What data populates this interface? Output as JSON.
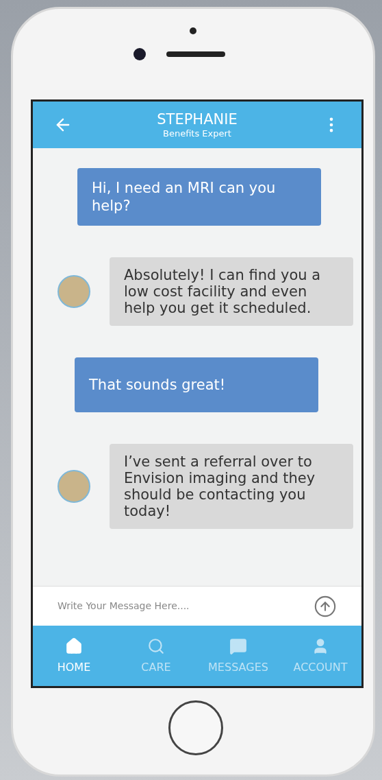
{
  "header": {
    "title": "STEPHANIE",
    "subtitle": "Benefits Expert"
  },
  "messages": [
    {
      "kind": "outgoing",
      "text": "Hi, I need an MRI can you help?"
    },
    {
      "kind": "incoming",
      "text": "Absolutely!  I can find you a low cost facility and even help you get it scheduled."
    },
    {
      "kind": "outgoing",
      "text": "That sounds great!"
    },
    {
      "kind": "incoming",
      "text": "I’ve sent a referral over to Envision imaging and they should be contacting you today!"
    }
  ],
  "composer": {
    "placeholder": "Write Your Message Here...."
  },
  "nav": [
    {
      "kind": "home",
      "label": "HOME",
      "selected": true
    },
    {
      "kind": "care",
      "label": "CARE",
      "selected": false
    },
    {
      "kind": "messages",
      "label": "MESSAGES",
      "selected": false
    },
    {
      "kind": "account",
      "label": "ACCOUNT",
      "selected": false
    }
  ]
}
